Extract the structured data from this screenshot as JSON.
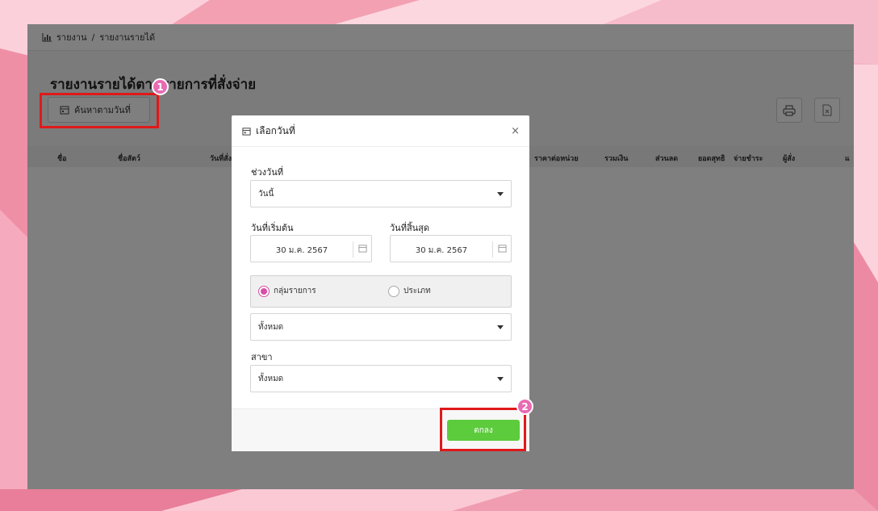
{
  "breadcrumb": {
    "root": "รายงาน",
    "separator": "/",
    "current": "รายงานรายได้"
  },
  "page": {
    "title": "รายงานรายได้ตามรายการที่สั่งจ่าย"
  },
  "toolbar": {
    "search_date_label": "ค้นหาตามวันที่",
    "print_icon": "printer-icon",
    "excel_icon": "excel-file-icon"
  },
  "table": {
    "columns": [
      "ชื่อ",
      "ชื่อสัตว์",
      "วันที่สั่ง",
      "ราคาต่อหน่วย",
      "รวมเงิน",
      "ส่วนลด",
      "ยอดสุทธิ",
      "จ่ายชำระ",
      "ผู้สั่ง",
      "แ"
    ]
  },
  "dialog": {
    "title": "เลือกวันที่",
    "close": "×",
    "range_label": "ช่วงวันที่",
    "range_value": "วันนี้",
    "start_label": "วันที่เริ่มต้น",
    "start_value": "30 ม.ค. 2567",
    "end_label": "วันที่สิ้นสุด",
    "end_value": "30 ม.ค. 2567",
    "radio_group": "กลุ่มรายการ",
    "radio_type": "ประเภท",
    "selected_radio": "กลุ่มรายการ",
    "group_value": "ทั้งหมด",
    "branch_label": "สาขา",
    "branch_value": "ทั้งหมด",
    "ok_label": "ตกลง"
  },
  "annotations": {
    "step1": "1",
    "step2": "2"
  },
  "colors": {
    "accent_pink": "#e86bb3",
    "radio_pink": "#d84fa5",
    "ok_green": "#5ccb3c",
    "highlight_red": "#e01919"
  }
}
